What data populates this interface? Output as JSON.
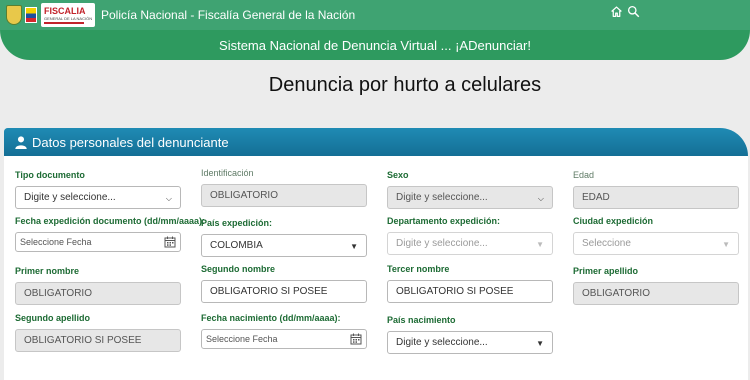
{
  "header": {
    "fiscalia_logo_text": "FISCALIA",
    "fiscalia_logo_sub": "GENERAL DE LA NACIÓN",
    "title": "Policía Nacional - Fiscalía General de la Nación",
    "icons": [
      "home-icon",
      "search-icon"
    ]
  },
  "banner": {
    "text": "Sistema Nacional de Denuncia Virtual ... ¡ADenunciar!"
  },
  "page": {
    "title": "Denuncia por hurto a celulares"
  },
  "panel": {
    "title": "Datos personales del denunciante",
    "icon": "user-icon"
  },
  "form": {
    "tipo_documento": {
      "label": "Tipo documento",
      "value": "Digite y seleccione..."
    },
    "identificacion": {
      "label": "Identificación",
      "value": "OBLIGATORIO"
    },
    "sexo": {
      "label": "Sexo",
      "value": "Digite y seleccione..."
    },
    "edad": {
      "label": "Edad",
      "value": "EDAD"
    },
    "fecha_expedicion": {
      "label": "Fecha expedición documento (dd/mm/aaaa):",
      "placeholder": "Seleccione Fecha"
    },
    "pais_expedicion": {
      "label": "País expedición:",
      "value": "COLOMBIA"
    },
    "departamento_expedicion": {
      "label": "Departamento expedición:",
      "value": "Digite y seleccione..."
    },
    "ciudad_expedicion": {
      "label": "Ciudad expedición",
      "value": "Seleccione"
    },
    "primer_nombre": {
      "label": "Primer nombre",
      "value": "OBLIGATORIO"
    },
    "segundo_nombre": {
      "label": "Segundo nombre",
      "placeholder": "OBLIGATORIO SI POSEE"
    },
    "tercer_nombre": {
      "label": "Tercer nombre",
      "placeholder": "OBLIGATORIO SI POSEE"
    },
    "primer_apellido": {
      "label": "Primer apellido",
      "value": "OBLIGATORIO"
    },
    "segundo_apellido": {
      "label": "Segundo apellido",
      "value": "OBLIGATORIO SI POSEE"
    },
    "fecha_nacimiento": {
      "label": "Fecha nacimiento (dd/mm/aaaa):",
      "placeholder": "Seleccione Fecha"
    },
    "pais_nacimiento": {
      "label": "País nacimiento",
      "value": "Digite y seleccione..."
    }
  },
  "colors": {
    "topbar": "#3fa372",
    "banner": "#2e9a5f",
    "panel_header": "#1f8bb4",
    "label_green": "#1d6b34"
  }
}
